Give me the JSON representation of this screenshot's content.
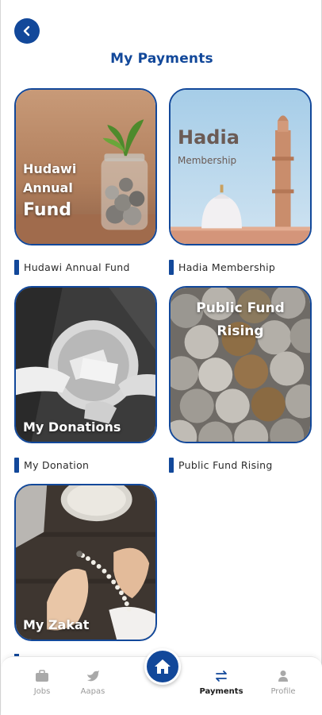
{
  "header": {
    "title": "My Payments"
  },
  "cards": [
    {
      "image_text_lines": [
        "Hudawi",
        "Annual",
        "Fund"
      ],
      "caption": "Hudawi Annual Fund"
    },
    {
      "image_title": "Hadia",
      "image_subtitle": "Membership",
      "caption": "Hadia Membership"
    },
    {
      "image_text": "My Donations",
      "caption": "My Donation"
    },
    {
      "image_text_lines": [
        "Public Fund",
        "Rising"
      ],
      "caption": "Public Fund Rising"
    },
    {
      "image_text": "My Zakat",
      "caption": ""
    }
  ],
  "bottom_nav": {
    "items": [
      {
        "label": "Jobs",
        "icon": "briefcase-icon"
      },
      {
        "label": "Aapas",
        "icon": "bird-icon"
      },
      {
        "label": "Payments",
        "icon": "transfer-arrows-icon",
        "active": true
      },
      {
        "label": "Profile",
        "icon": "person-icon"
      }
    ],
    "home_icon": "home-icon"
  },
  "colors": {
    "primary": "#12489a",
    "inactive": "#9a9a9a"
  }
}
